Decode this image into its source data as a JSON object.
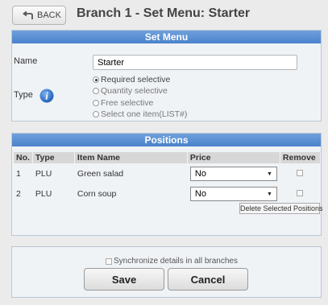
{
  "header": {
    "back_label": "BACK",
    "title": "Branch 1 - Set Menu: Starter"
  },
  "set_menu": {
    "title": "Set Menu",
    "name_label": "Name",
    "name_value": "Starter",
    "type_label": "Type",
    "type_options": [
      {
        "label": "Required selective",
        "selected": true
      },
      {
        "label": "Quantity selective",
        "selected": false
      },
      {
        "label": "Free selective",
        "selected": false
      },
      {
        "label": "Select one item(LIST#)",
        "selected": false
      }
    ]
  },
  "positions": {
    "title": "Positions",
    "columns": [
      "No.",
      "Type",
      "Item Name",
      "Price",
      "Remove"
    ],
    "rows": [
      {
        "no": "1",
        "type": "PLU",
        "item_name": "Green salad",
        "price": "No",
        "remove": false
      },
      {
        "no": "2",
        "type": "PLU",
        "item_name": "Corn soup",
        "price": "No",
        "remove": false
      }
    ],
    "delete_label": "Delete Selected Positions"
  },
  "footer": {
    "sync_label": "Synchronize details in all branches",
    "sync_checked": false,
    "save_label": "Save",
    "cancel_label": "Cancel"
  },
  "colors": {
    "panel_header": "#5a90d6",
    "panel_border": "#b9c8d8",
    "info_icon": "#2f6fc9"
  }
}
